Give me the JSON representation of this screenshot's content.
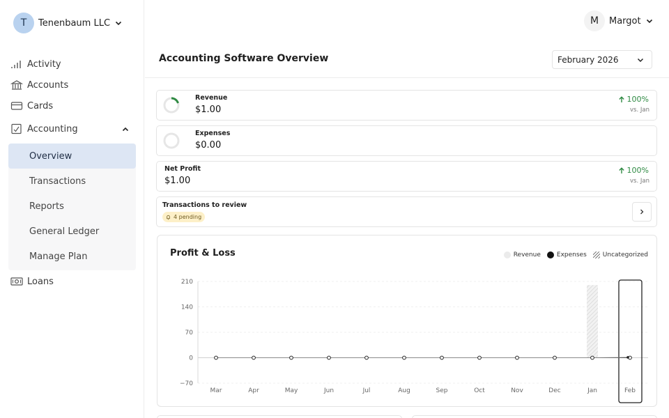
{
  "org": {
    "initial": "T",
    "name": "Tenenbaum LLC"
  },
  "user": {
    "initial": "M",
    "name": "Margot"
  },
  "nav": {
    "activity": "Activity",
    "accounts": "Accounts",
    "cards": "Cards",
    "accounting": "Accounting",
    "loans": "Loans"
  },
  "subnav": [
    "Overview",
    "Transactions",
    "Reports",
    "General Ledger",
    "Manage Plan"
  ],
  "page": {
    "title": "Accounting Software Overview",
    "period": "February 2026"
  },
  "metrics": {
    "revenue": {
      "label": "Revenue",
      "value": "$1.00",
      "delta": "100%",
      "delta_sub": "vs. Jan"
    },
    "expenses": {
      "label": "Expenses",
      "value": "$0.00"
    },
    "net_profit": {
      "label": "Net Profit",
      "value": "$1.00",
      "delta": "100%",
      "delta_sub": "vs. Jan"
    },
    "review": {
      "label": "Transactions to review",
      "pending": "4 pending"
    }
  },
  "colors": {
    "accent": "#dde6f4",
    "positive": "#2f8a43",
    "pending_bg": "#fdf0c8"
  },
  "chart_data": {
    "type": "line",
    "title": "Profit & Loss",
    "categories": [
      "Mar",
      "Apr",
      "May",
      "Jun",
      "Jul",
      "Aug",
      "Sep",
      "Oct",
      "Nov",
      "Dec",
      "Jan",
      "Feb"
    ],
    "yticks": [
      "210",
      "140",
      "70",
      "0",
      "−70"
    ],
    "ylim": [
      -70,
      210
    ],
    "grid": true,
    "legend_position": "top-right",
    "legend": [
      "Revenue",
      "Expenses",
      "Uncategorized"
    ],
    "series": [
      {
        "name": "Revenue",
        "values": [
          0,
          0,
          0,
          0,
          0,
          0,
          0,
          0,
          0,
          0,
          0,
          1
        ]
      },
      {
        "name": "Expenses",
        "values": [
          0,
          0,
          0,
          0,
          0,
          0,
          0,
          0,
          0,
          0,
          0,
          0
        ]
      },
      {
        "name": "Uncategorized",
        "values": [
          0,
          0,
          0,
          0,
          0,
          0,
          0,
          0,
          0,
          0,
          200,
          0
        ]
      }
    ],
    "highlight": "Feb"
  }
}
